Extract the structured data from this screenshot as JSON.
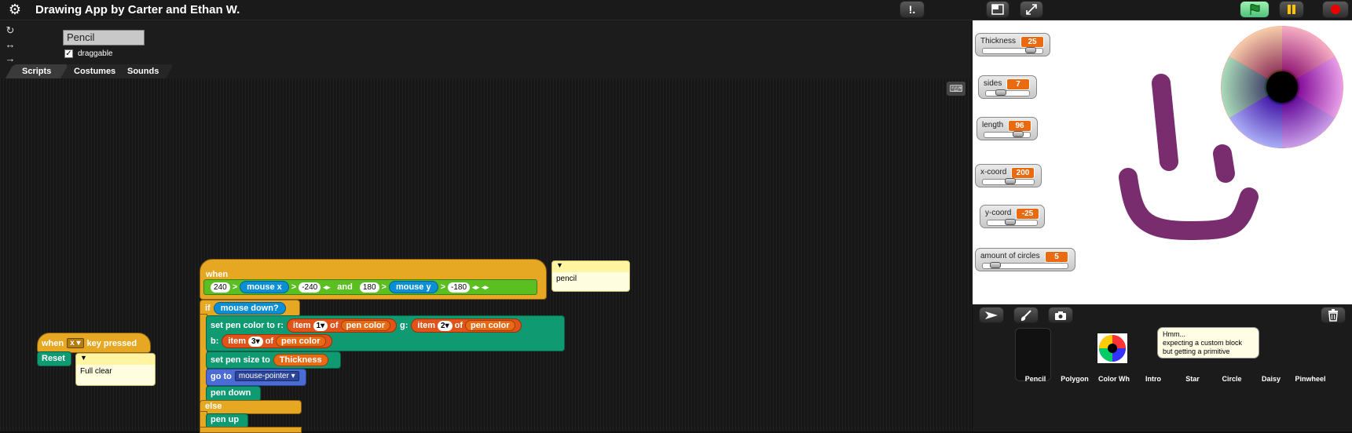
{
  "app": {
    "title": "Drawing App by Carter and Ethan W.",
    "prefs_label": "!."
  },
  "sprite": {
    "name": "Pencil",
    "draggable_label": "draggable",
    "draggable_checked": "✓"
  },
  "tabs": [
    "Scripts",
    "Costumes",
    "Sounds"
  ],
  "scripts": {
    "when_key": {
      "when": "when",
      "key": "x",
      "key_pressed": "key pressed",
      "reset": "Reset",
      "comment": "Full clear"
    },
    "main": {
      "when": "when",
      "cond_left_a": "240",
      "cond_left_op1": ">",
      "cond_left_var": "mouse x",
      "cond_left_op2": ">",
      "cond_left_b": "-240",
      "and": "and",
      "cond_right_a": "180",
      "cond_right_op1": ">",
      "cond_right_var": "mouse y",
      "cond_right_op2": ">",
      "cond_right_b": "-180",
      "comment": "pencil",
      "if": "if",
      "mouse_down": "mouse down?",
      "set_pen_color_to_r": "set pen color to r:",
      "item": "item",
      "of": "of",
      "pen_color": "pen color",
      "g": "g:",
      "b": "b:",
      "idx1": "1",
      "idx2": "2",
      "idx3": "3",
      "set_pen_size_to": "set pen size to",
      "thickness": "Thickness",
      "go_to": "go to",
      "mouse_pointer": "mouse-pointer",
      "pen_down": "pen down",
      "else": "else",
      "pen_up": "pen up"
    }
  },
  "watchers": [
    {
      "label": "Thickness",
      "value": "25",
      "slider_fraction": 0.87
    },
    {
      "label": "sides",
      "value": "7",
      "slider_fraction": 0.3
    },
    {
      "label": "length",
      "value": "96",
      "slider_fraction": 0.82
    },
    {
      "label": "x-coord",
      "value": "200",
      "slider_fraction": 0.55
    },
    {
      "label": "y-coord",
      "value": "-25",
      "slider_fraction": 0.45
    },
    {
      "label": "amount of circles",
      "value": "5",
      "slider_fraction": 0.1
    }
  ],
  "sprites": [
    "Pencil",
    "Polygon",
    "Color Wh",
    "Intro",
    "Star",
    "Circle",
    "Daisy",
    "Pinwheel"
  ],
  "tooltip": {
    "line1": "Hmm...",
    "line2": "expecting a custom block",
    "line3": "but getting a primitive"
  },
  "colors": {
    "control": "#e6a823",
    "pen": "#0f9a72",
    "sensing": "#0a8fd4",
    "variables": "#e86a15",
    "operators": "#5bbf21",
    "motion": "#4a6cd4",
    "drawing_stroke": "#7a2d6e"
  },
  "icons": [
    "gear-icon",
    "stage-size-icon",
    "fullscreen-icon",
    "green-flag-icon",
    "pause-icon",
    "stop-icon",
    "keyboard-icon",
    "arrow-icon",
    "paintbrush-icon",
    "camera-icon",
    "trash-icon"
  ]
}
